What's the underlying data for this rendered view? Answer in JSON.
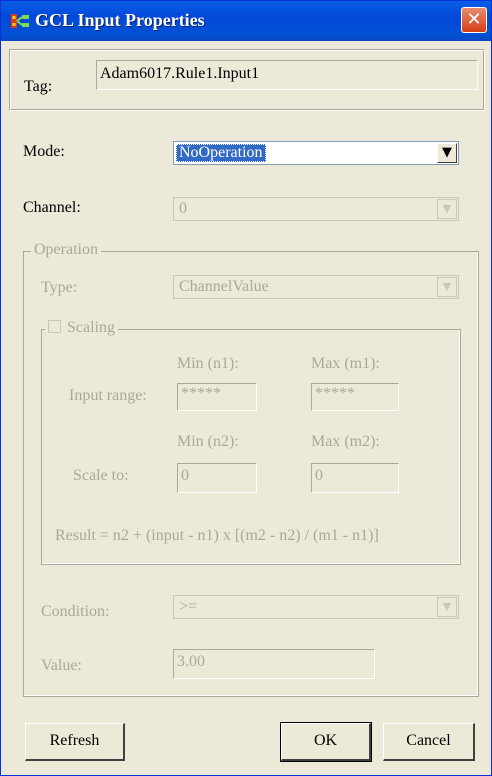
{
  "window": {
    "title": "GCL Input Properties",
    "close_glyph": "✕"
  },
  "tag": {
    "label": "Tag:",
    "value": "Adam6017.Rule1.Input1"
  },
  "mode": {
    "label": "Mode:",
    "value": "NoOperation"
  },
  "channel": {
    "label": "Channel:",
    "value": "0"
  },
  "operation": {
    "legend": "Operation",
    "type": {
      "label": "Type:",
      "value": "ChannelValue"
    },
    "scaling": {
      "legend": "Scaling",
      "checked": false,
      "min_n1_label": "Min (n1):",
      "max_m1_label": "Max (m1):",
      "input_range_label": "Input range:",
      "min_n1_value": "*****",
      "max_m1_value": "*****",
      "min_n2_label": "Min (n2):",
      "max_m2_label": "Max (m2):",
      "scale_to_label": "Scale to:",
      "min_n2_value": "0",
      "max_m2_value": "0",
      "formula": "Result = n2 + (input - n1) x [(m2 - n2) / (m1 - n1)]"
    },
    "condition": {
      "label": "Condition:",
      "value": ">="
    },
    "value": {
      "label": "Value:",
      "value": "3.00"
    }
  },
  "buttons": {
    "refresh": "Refresh",
    "ok": "OK",
    "cancel": "Cancel"
  },
  "icons": {
    "dropdown": "▼"
  }
}
